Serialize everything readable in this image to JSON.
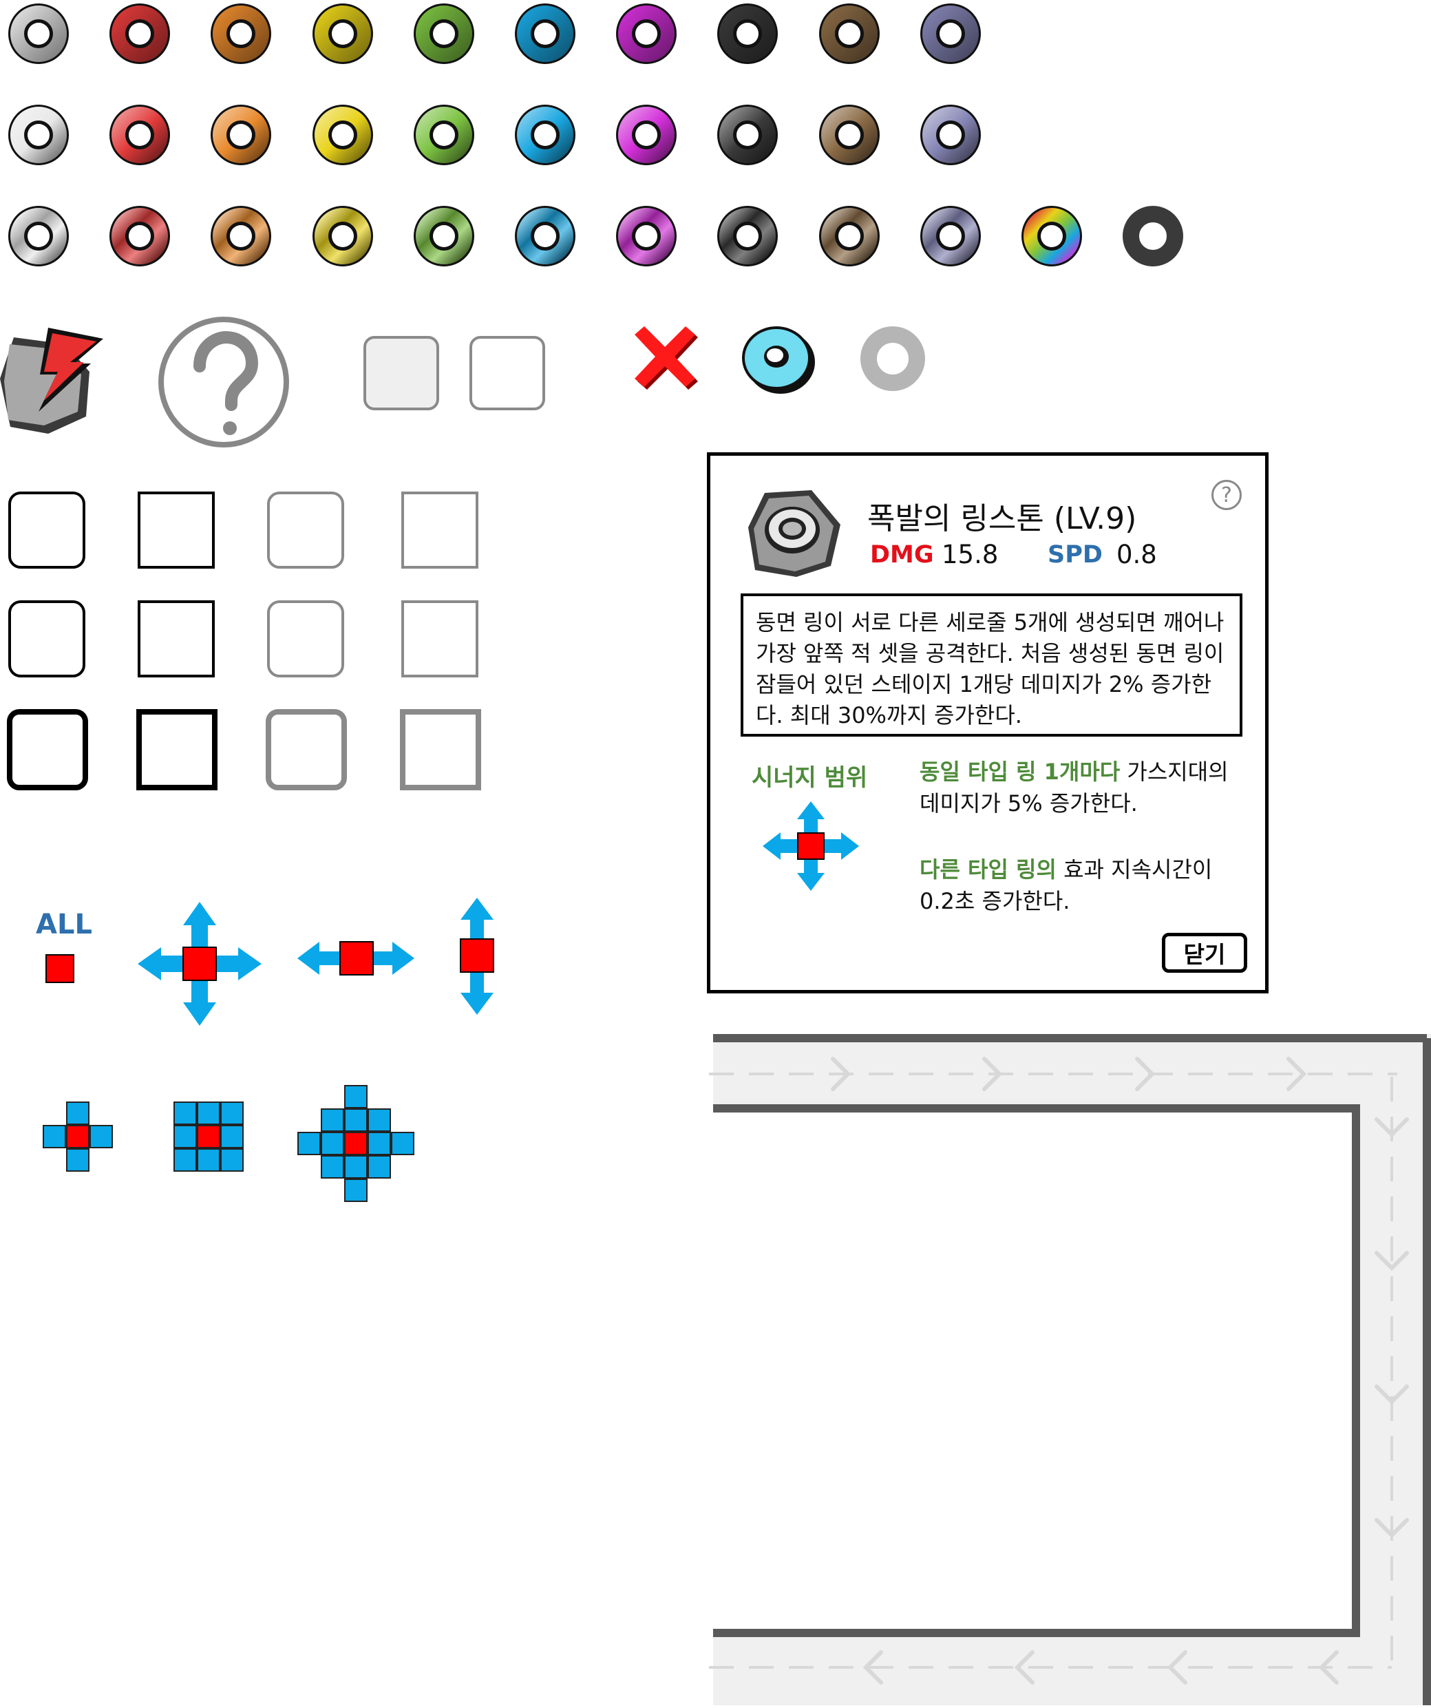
{
  "colors": {
    "ring_palette": [
      "#e8e8e8",
      "#e23b3b",
      "#e88a2e",
      "#e8d21a",
      "#7cc242",
      "#1aa6e0",
      "#d22fd8",
      "#3a3a3a",
      "#8a6a45",
      "#8585b5"
    ],
    "rainbow": [
      "#e23b3b",
      "#e8d21a",
      "#7cc242",
      "#1aa6e0",
      "#d22fd8"
    ],
    "arrow_blue": "#0aa8e8",
    "center_red": "#ff0000",
    "highlight_green": "#4e8b3a",
    "dmg_red": "#e3101a",
    "spd_blue": "#2e6fad"
  },
  "icons": {
    "top": [
      "lightning-rock-icon",
      "question-circle-icon",
      "slot-filled-icon",
      "slot-empty-icon",
      "close-x-icon",
      "cyan-ring-icon",
      "gray-ring-icon"
    ]
  },
  "range_icons": {
    "all_label": "ALL"
  },
  "popup": {
    "title": "폭발의 링스톤 (LV.9)",
    "help_glyph": "?",
    "dmg_label": "DMG",
    "dmg_value": "15.8",
    "spd_label": "SPD",
    "spd_value": "0.8",
    "description": "동면 링이 서로 다른 세로줄 5개에 생성되면 깨어나 가장 앞쪽 적 셋을 공격한다. 처음 생성된 동면 링이 잠들어 있던 스테이지 1개당 데미지가 2% 증가한다. 최대 30%까지 증가한다.",
    "synergy_title": "시너지 범위",
    "effect1_highlight": "동일 타입 링 1개마다",
    "effect1_rest": " 가스지대의 데미지가 5% 증가한다.",
    "effect2_highlight": "다른 타입 링의",
    "effect2_rest": " 효과 지속시간이 0.2초 증가한다.",
    "close_label": "닫기"
  }
}
